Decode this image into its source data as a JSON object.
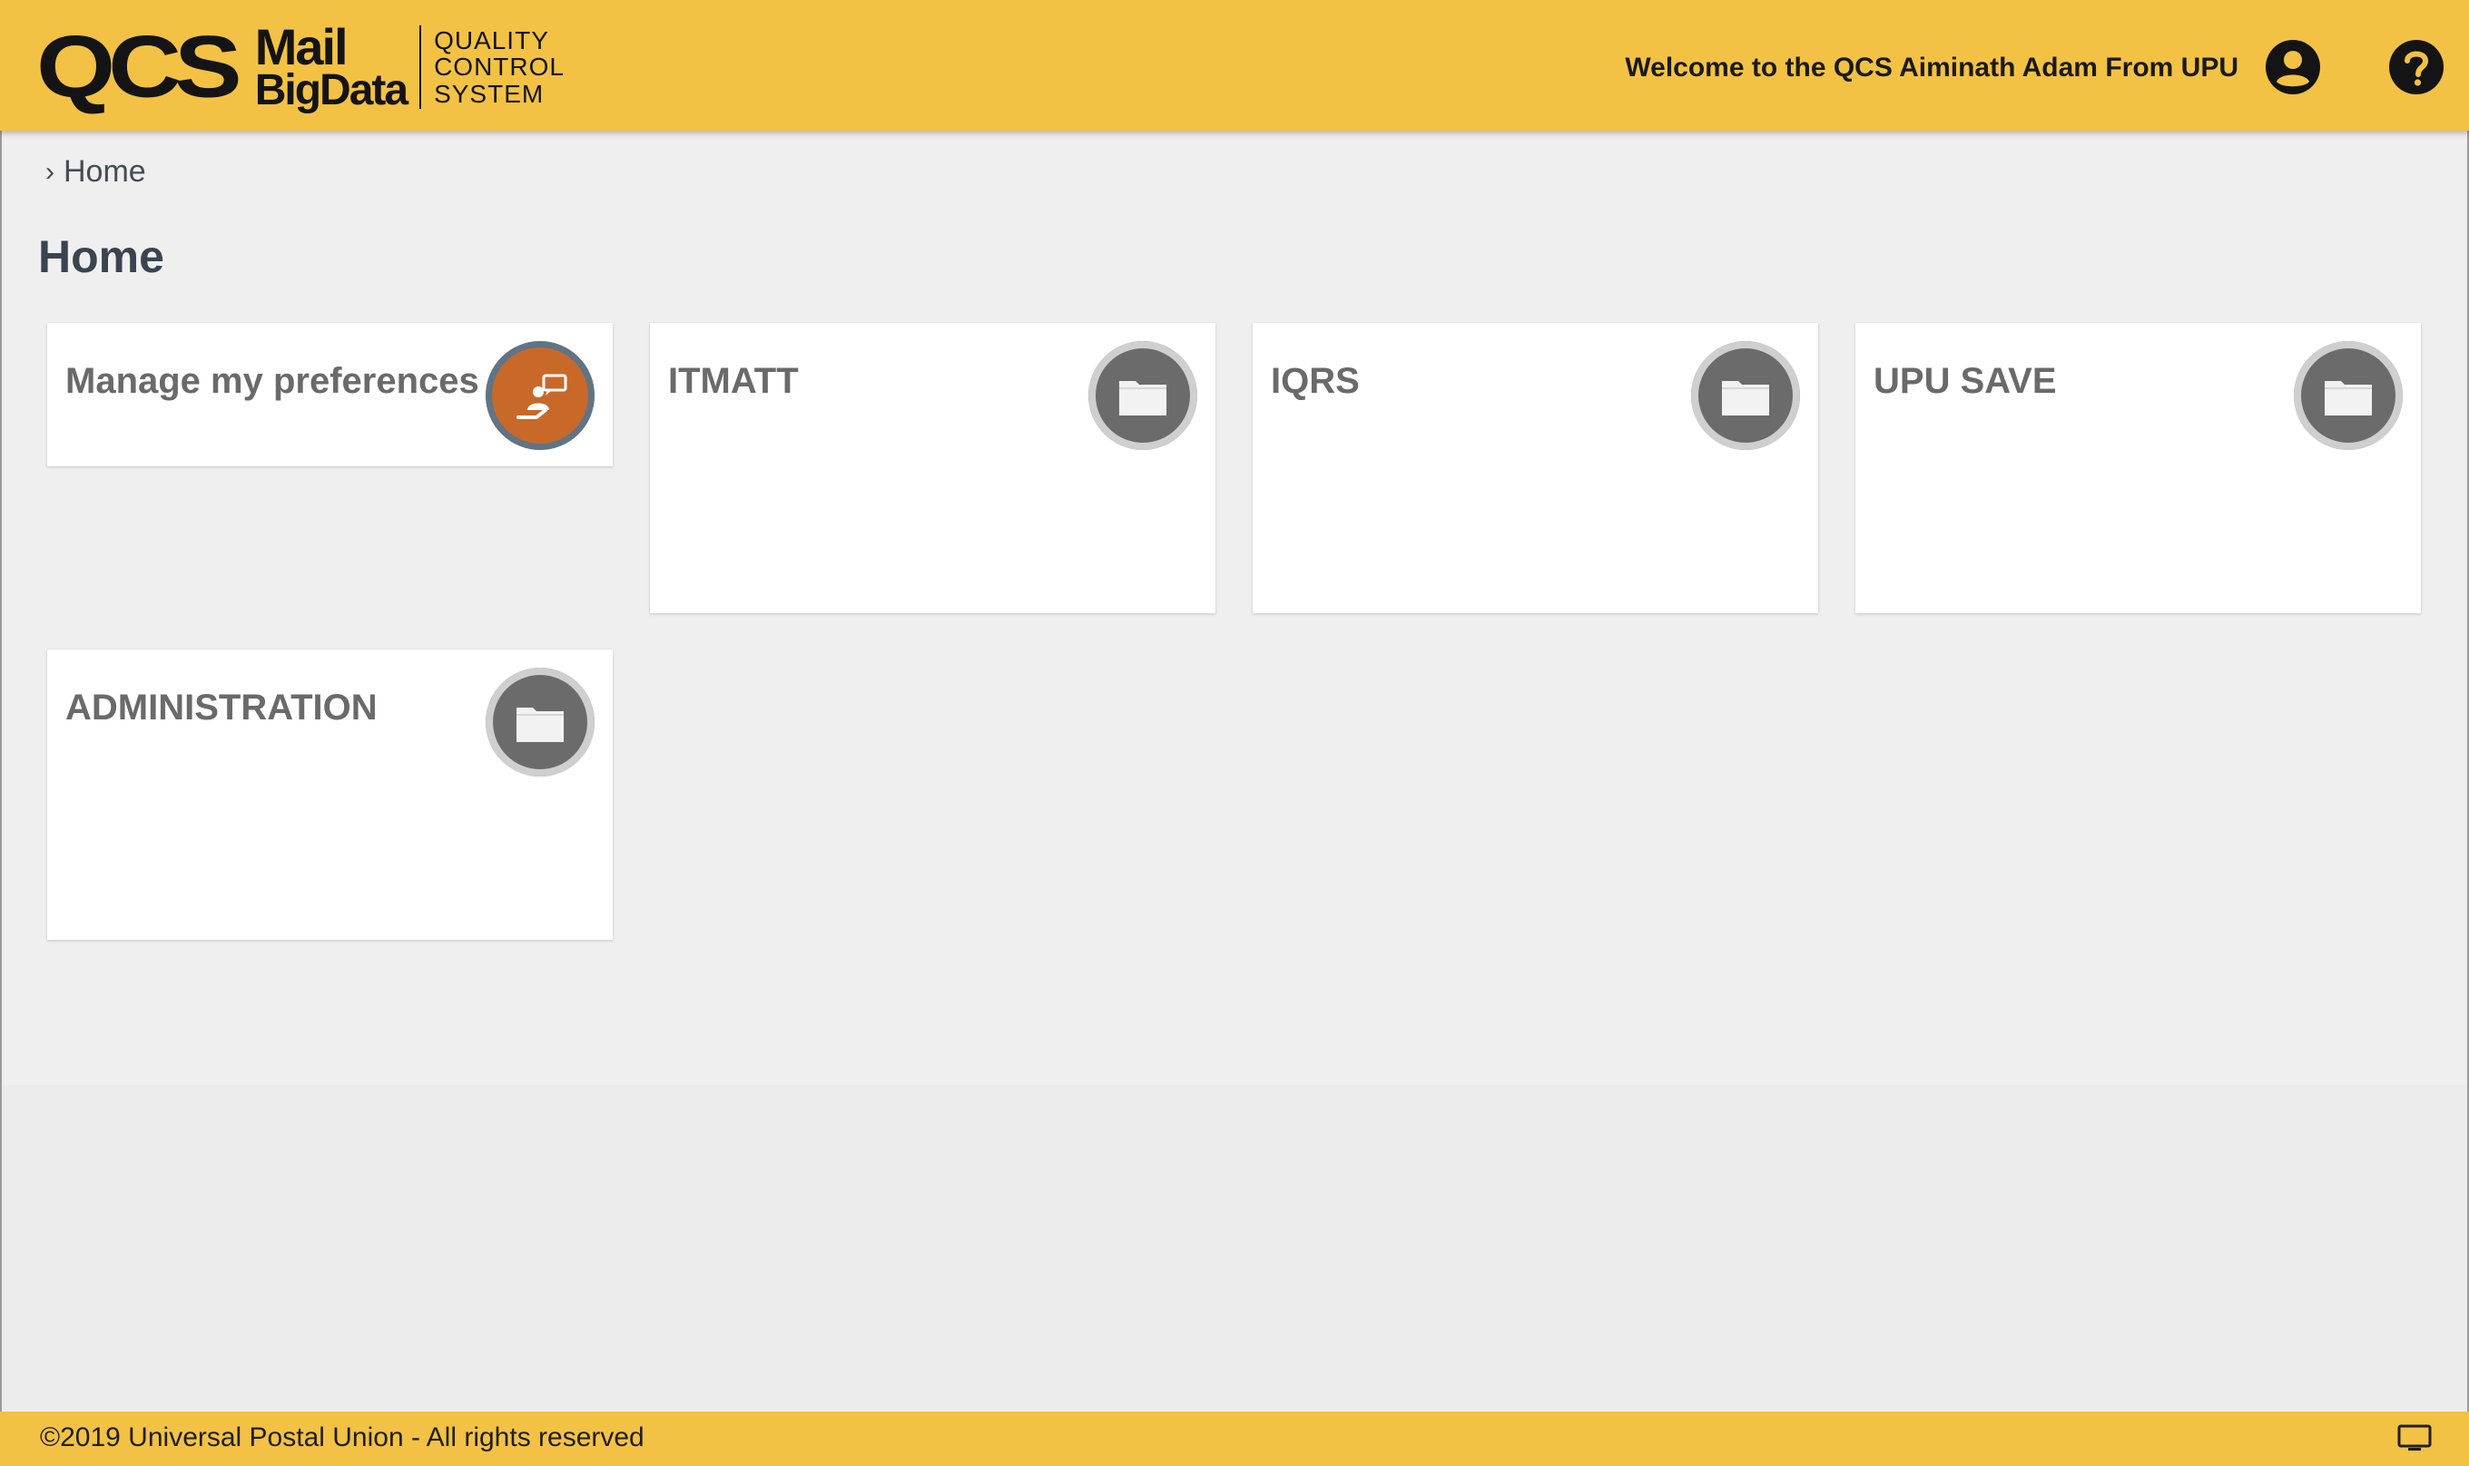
{
  "header": {
    "logo": {
      "qcs": "QCS",
      "mail": "Mail",
      "bigdata": "BigData",
      "tagline": [
        "QUALITY",
        "CONTROL",
        "SYSTEM"
      ]
    },
    "welcome_text": "Welcome to the QCS Aiminath Adam From UPU",
    "user_icon": "account-circle-icon",
    "help_icon": "help-circle-icon"
  },
  "breadcrumb": {
    "separator": "›",
    "items": [
      "Home"
    ]
  },
  "page_title": "Home",
  "tiles": [
    {
      "label": "Manage my preferences",
      "icon": "preferences-icon"
    },
    {
      "label": "ITMATT",
      "icon": "folder-icon"
    },
    {
      "label": "IQRS",
      "icon": "folder-icon"
    },
    {
      "label": "UPU SAVE",
      "icon": "folder-icon"
    },
    {
      "label": "ADMINISTRATION",
      "icon": "folder-icon"
    }
  ],
  "footer": {
    "copyright": "©2019 Universal Postal Union - All rights reserved",
    "monitor_icon": "monitor-icon"
  },
  "colors": {
    "brand_yellow": "#f3c244",
    "preferences_orange": "#c8692a",
    "folder_gray": "#6b6b6b"
  }
}
